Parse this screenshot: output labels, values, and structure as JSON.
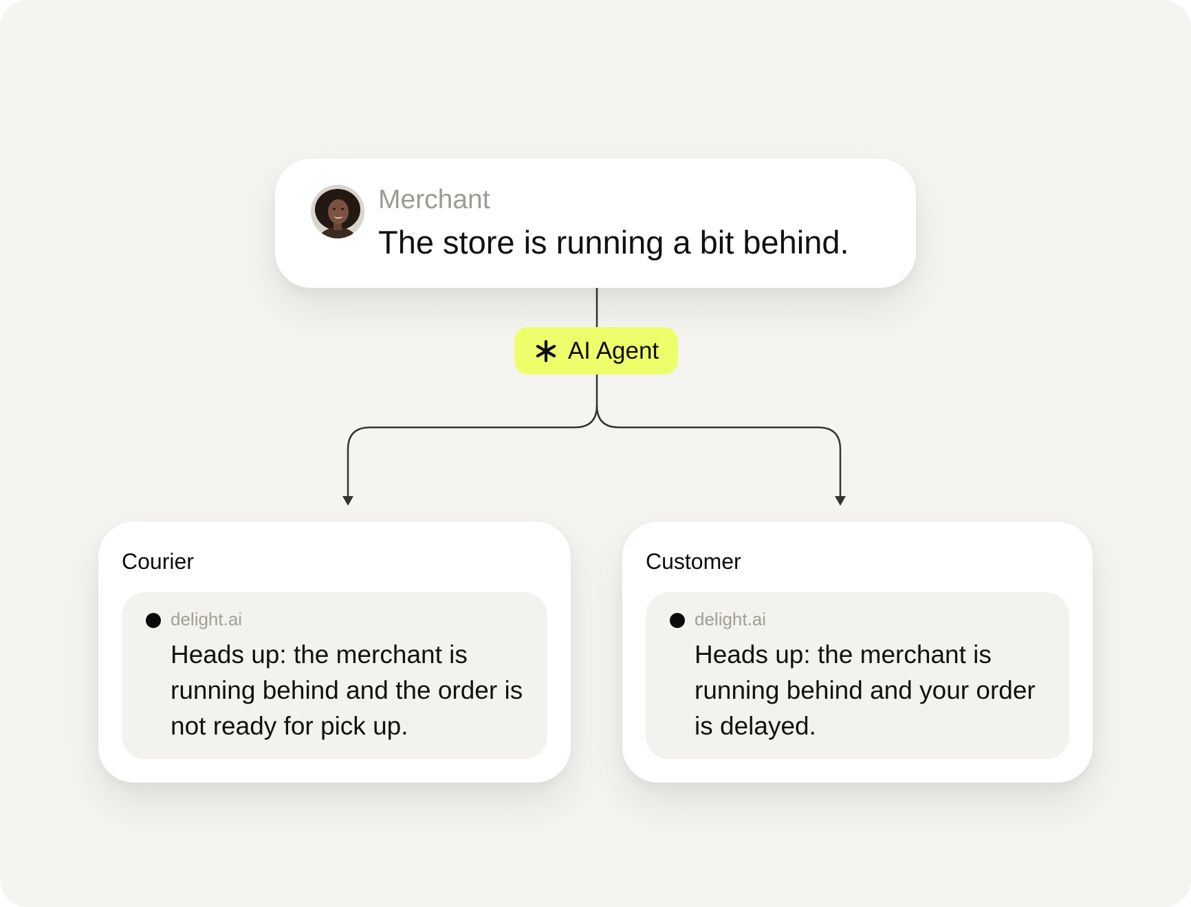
{
  "merchant": {
    "name": "Merchant",
    "message": "The store is running a bit behind."
  },
  "agent": {
    "icon": "asterisk-icon",
    "label": "AI Agent",
    "color": "#eefe6a"
  },
  "recipients": [
    {
      "title": "Courier",
      "sender": "delight.ai",
      "message": "Heads up: the merchant is running behind and the order is not ready for pick up."
    },
    {
      "title": "Customer",
      "sender": "delight.ai",
      "message": "Heads up: the merchant is running behind and your order is delayed."
    }
  ],
  "colors": {
    "background": "#f5f4f0",
    "card": "#ffffff",
    "notice": "#f3f2ee",
    "muted_text": "#9e9a92",
    "connector": "#333333"
  }
}
